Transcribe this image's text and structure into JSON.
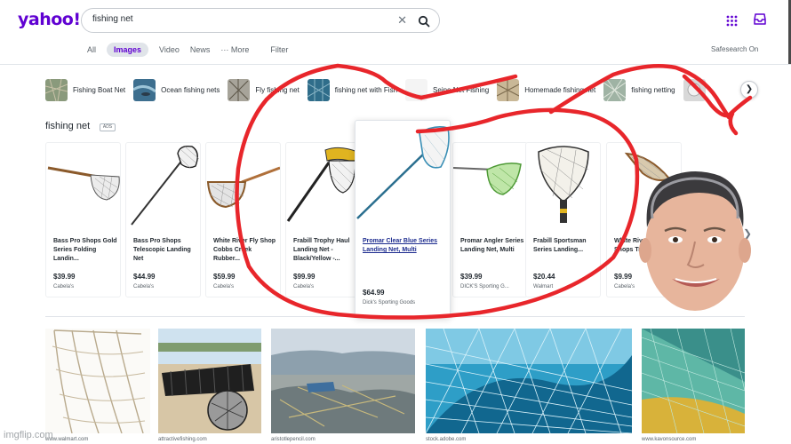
{
  "header": {
    "logo": "yahoo!",
    "search_value": "fishing net",
    "clear_label": "✕"
  },
  "tabs": [
    {
      "label": "All"
    },
    {
      "label": "Images",
      "active": true
    },
    {
      "label": "Video"
    },
    {
      "label": "News"
    },
    {
      "label": "··· More"
    },
    {
      "label": "Filter"
    }
  ],
  "safesearch": "Safesearch On",
  "related": [
    {
      "label": "Fishing Boat Net"
    },
    {
      "label": "Ocean fishing nets"
    },
    {
      "label": "Fly fishing net"
    },
    {
      "label": "fishing net with Fish"
    },
    {
      "label": "Seine Net Fishing"
    },
    {
      "label": "Homemade fishing net"
    },
    {
      "label": "fishing netting"
    }
  ],
  "shopping": {
    "title": "fishing net",
    "ads_badge": "ADS",
    "products": [
      {
        "title": "Bass Pro Shops Gold Series Folding Landin...",
        "price": "$39.99",
        "store": "Cabela's"
      },
      {
        "title": "Bass Pro Shops Telescopic Landing Net",
        "price": "$44.99",
        "store": "Cabela's"
      },
      {
        "title": "White River Fly Shop Cobbs Creek Rubber...",
        "price": "$59.99",
        "store": "Cabela's"
      },
      {
        "title": "Frabill Trophy Haul Landing Net - Black/Yellow -...",
        "price": "$99.99",
        "store": "Cabela's"
      },
      {
        "title": "Promar Clear Blue Series Landing Net, Multi",
        "price": "$64.99",
        "store": "Dick's Sporting Goods"
      },
      {
        "title": "Promar Angler Series Landing Net, Multi",
        "price": "$39.99",
        "store": "DICK'S Sporting G..."
      },
      {
        "title": "Frabill Sportsman Series Landing...",
        "price": "$20.44",
        "store": "Walmart"
      },
      {
        "title": "White River Fly Shops Trout...",
        "price": "$9.99",
        "store": "Cabela's"
      }
    ]
  },
  "images": [
    {
      "source": "www.walmart.com"
    },
    {
      "source": "attractivefishing.com"
    },
    {
      "source": "aristotlepencil.com"
    },
    {
      "source": "stock.adobe.com"
    },
    {
      "source": "www.kavonsource.com"
    }
  ],
  "watermark": "imgflip.com",
  "colors": {
    "brand": "#6001d2",
    "scribble": "#e8262b"
  }
}
